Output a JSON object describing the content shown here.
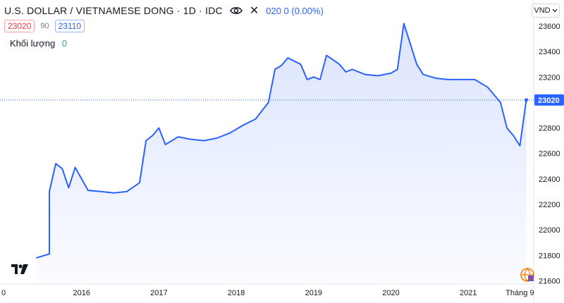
{
  "header": {
    "title": "U.S. DOLLAR / VIETNAMESE DONG · 1D · IDC",
    "change": "020  0 (0.00%)",
    "bid": "23020",
    "spread": "90",
    "ask": "23110",
    "volume_label": "Khối lượng",
    "volume_value": "0",
    "currency": "VND"
  },
  "icons": {
    "visibility": "eye-icon",
    "close": "close-icon",
    "dropdown": "chevron-down-icon",
    "brand": "tradingview-logo-icon",
    "globe": "globe-icon"
  },
  "colors": {
    "line": "#2962ff",
    "fill": "#d6e0ff",
    "last_price": "#2962ff",
    "up": "#26a69a",
    "down": "#f23645"
  },
  "chart_data": {
    "type": "area",
    "ylim": [
      21580,
      23650
    ],
    "x_ticks": [
      "0",
      "2016",
      "2017",
      "2018",
      "2019",
      "2020",
      "2021",
      "Tháng 9"
    ],
    "y_ticks": [
      21600,
      21800,
      22000,
      22200,
      22400,
      22600,
      22800,
      23000,
      23200,
      23400,
      23600
    ],
    "last_price": 23020,
    "x": [
      "2015-06",
      "2015-08",
      "2015-08",
      "2015-09",
      "2015-10",
      "2015-11",
      "2015-12",
      "2016-02",
      "2016-04",
      "2016-06",
      "2016-08",
      "2016-10",
      "2016-11",
      "2016-12",
      "2017-01",
      "2017-02",
      "2017-04",
      "2017-06",
      "2017-08",
      "2017-10",
      "2017-12",
      "2018-02",
      "2018-04",
      "2018-06",
      "2018-07",
      "2018-08",
      "2018-09",
      "2018-11",
      "2018-12",
      "2019-01",
      "2019-02",
      "2019-03",
      "2019-05",
      "2019-06",
      "2019-07",
      "2019-09",
      "2019-11",
      "2020-01",
      "2020-02",
      "2020-03",
      "2020-04",
      "2020-05",
      "2020-06",
      "2020-08",
      "2020-10",
      "2020-12",
      "2021-02",
      "2021-04",
      "2021-06",
      "2021-07",
      "2021-08",
      "2021-09",
      "2021-10"
    ],
    "values": [
      21780,
      21810,
      22300,
      22520,
      22480,
      22330,
      22490,
      22310,
      22300,
      22290,
      22300,
      22370,
      22700,
      22740,
      22800,
      22670,
      22730,
      22710,
      22700,
      22720,
      22760,
      22820,
      22870,
      23000,
      23260,
      23290,
      23350,
      23300,
      23180,
      23200,
      23180,
      23370,
      23300,
      23240,
      23260,
      23220,
      23210,
      23230,
      23260,
      23620,
      23460,
      23300,
      23220,
      23190,
      23180,
      23180,
      23180,
      23120,
      23000,
      22800,
      22740,
      22660,
      23020
    ]
  }
}
